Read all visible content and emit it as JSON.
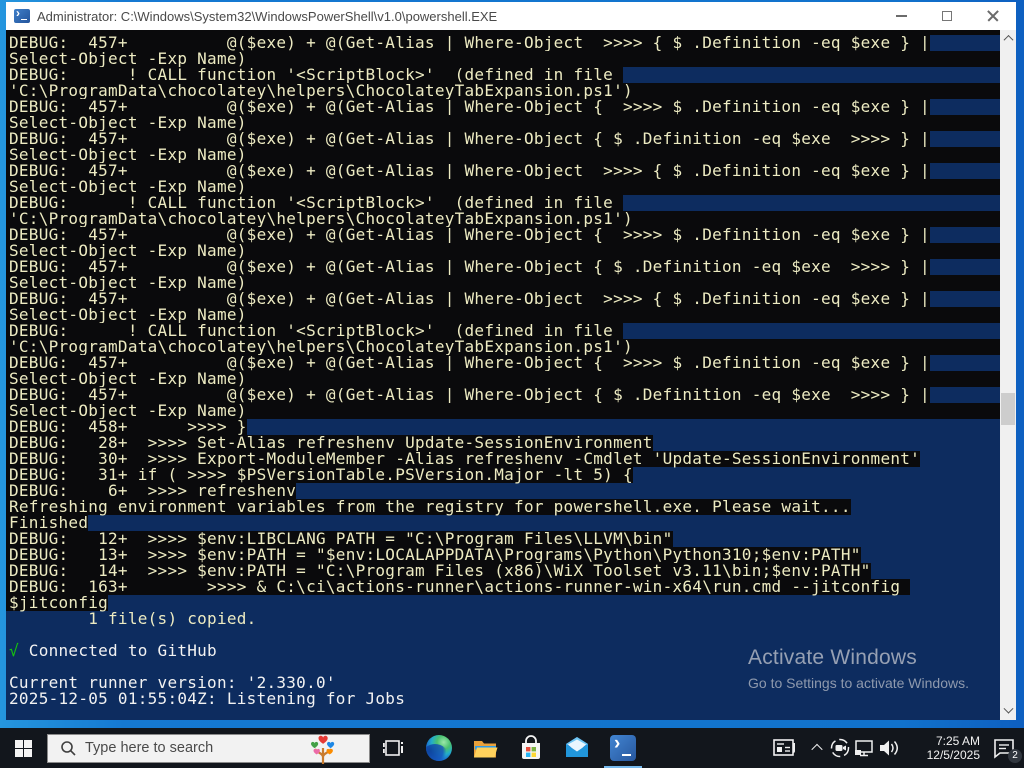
{
  "window": {
    "title": "Administrator: C:\\Windows\\System32\\WindowsPowerShell\\v1.0\\powershell.EXE"
  },
  "console": {
    "rows": [
      {
        "z": 1,
        "c": "b",
        "s": [
          {
            "t": "DEBUG:  457+          @($exe) + @(Get-Alias | Where-Object  >>>> { $_.Definition -eq $exe } |",
            "f": "y"
          }
        ]
      },
      {
        "z": 1,
        "c": "k",
        "s": [
          {
            "t": "Select-Object -Exp Name)",
            "f": "y"
          }
        ]
      },
      {
        "z": 1,
        "c": "b",
        "s": [
          {
            "t": "DEBUG:      ! CALL function '<ScriptBlock>'  (defined in file ",
            "f": "y"
          }
        ]
      },
      {
        "z": 1,
        "c": "k",
        "s": [
          {
            "t": "'C:\\ProgramData\\chocolatey\\helpers\\ChocolateyTabExpansion.ps1')",
            "f": "y"
          }
        ]
      },
      {
        "z": 1,
        "c": "b",
        "s": [
          {
            "t": "DEBUG:  457+          @($exe) + @(Get-Alias | Where-Object {  >>>> $_.Definition -eq $exe } |",
            "f": "y"
          }
        ]
      },
      {
        "z": 1,
        "c": "k",
        "s": [
          {
            "t": "Select-Object -Exp Name)",
            "f": "y"
          }
        ]
      },
      {
        "z": 1,
        "c": "b",
        "s": [
          {
            "t": "DEBUG:  457+          @($exe) + @(Get-Alias | Where-Object { $_.Definition -eq $exe  >>>> } |",
            "f": "y"
          }
        ]
      },
      {
        "z": 1,
        "c": "k",
        "s": [
          {
            "t": "Select-Object -Exp Name)",
            "f": "y"
          }
        ]
      },
      {
        "z": 1,
        "c": "b",
        "s": [
          {
            "t": "DEBUG:  457+          @($exe) + @(Get-Alias | Where-Object  >>>> { $_.Definition -eq $exe } |",
            "f": "y"
          }
        ]
      },
      {
        "z": 1,
        "c": "k",
        "s": [
          {
            "t": "Select-Object -Exp Name)",
            "f": "y"
          }
        ]
      },
      {
        "z": 1,
        "c": "b",
        "s": [
          {
            "t": "DEBUG:      ! CALL function '<ScriptBlock>'  (defined in file ",
            "f": "y"
          }
        ]
      },
      {
        "z": 1,
        "c": "k",
        "s": [
          {
            "t": "'C:\\ProgramData\\chocolatey\\helpers\\ChocolateyTabExpansion.ps1')",
            "f": "y"
          }
        ]
      },
      {
        "z": 1,
        "c": "b",
        "s": [
          {
            "t": "DEBUG:  457+          @($exe) + @(Get-Alias | Where-Object {  >>>> $_.Definition -eq $exe } |",
            "f": "y"
          }
        ]
      },
      {
        "z": 1,
        "c": "k",
        "s": [
          {
            "t": "Select-Object -Exp Name)",
            "f": "y"
          }
        ]
      },
      {
        "z": 1,
        "c": "b",
        "s": [
          {
            "t": "DEBUG:  457+          @($exe) + @(Get-Alias | Where-Object { $_.Definition -eq $exe  >>>> } |",
            "f": "y"
          }
        ]
      },
      {
        "z": 1,
        "c": "k",
        "s": [
          {
            "t": "Select-Object -Exp Name)",
            "f": "y"
          }
        ]
      },
      {
        "z": 1,
        "c": "b",
        "s": [
          {
            "t": "DEBUG:  457+          @($exe) + @(Get-Alias | Where-Object  >>>> { $_.Definition -eq $exe } |",
            "f": "y"
          }
        ]
      },
      {
        "z": 1,
        "c": "k",
        "s": [
          {
            "t": "Select-Object -Exp Name)",
            "f": "y"
          }
        ]
      },
      {
        "z": 1,
        "c": "b",
        "s": [
          {
            "t": "DEBUG:      ! CALL function '<ScriptBlock>'  (defined in file ",
            "f": "y"
          }
        ]
      },
      {
        "z": 1,
        "c": "k",
        "s": [
          {
            "t": "'C:\\ProgramData\\chocolatey\\helpers\\ChocolateyTabExpansion.ps1')",
            "f": "y"
          }
        ]
      },
      {
        "z": 1,
        "c": "b",
        "s": [
          {
            "t": "DEBUG:  457+          @($exe) + @(Get-Alias | Where-Object {  >>>> $_.Definition -eq $exe } |",
            "f": "y"
          }
        ]
      },
      {
        "z": 1,
        "c": "k",
        "s": [
          {
            "t": "Select-Object -Exp Name)",
            "f": "y"
          }
        ]
      },
      {
        "z": 1,
        "c": "b",
        "s": [
          {
            "t": "DEBUG:  457+          @($exe) + @(Get-Alias | Where-Object { $_.Definition -eq $exe  >>>> } |",
            "f": "y"
          }
        ]
      },
      {
        "z": 1,
        "c": "k",
        "s": [
          {
            "t": "Select-Object -Exp Name)",
            "f": "y"
          }
        ]
      },
      {
        "z": 2,
        "c": "b",
        "s": [
          {
            "t": "DEBUG:  458+      >>>> }",
            "f": "y"
          }
        ]
      },
      {
        "z": 2,
        "c": "b",
        "s": [
          {
            "t": "DEBUG:   28+  >>>> Set-Alias refreshenv Update-SessionEnvironment",
            "f": "y"
          }
        ]
      },
      {
        "z": 2,
        "c": "b",
        "s": [
          {
            "t": "DEBUG:   30+  >>>> Export-ModuleMember -Alias refreshenv -Cmdlet 'Update-SessionEnvironment'",
            "f": "y"
          }
        ]
      },
      {
        "z": 2,
        "c": "b",
        "s": [
          {
            "t": "DEBUG:   31+ if ( >>>> $PSVersionTable.PSVersion.Major -lt 5) {",
            "f": "y"
          }
        ]
      },
      {
        "z": 2,
        "c": "b",
        "s": [
          {
            "t": "DEBUG:    6+  >>>> refreshenv",
            "f": "y"
          }
        ]
      },
      {
        "z": 2,
        "c": "b",
        "s": [
          {
            "t": "Refreshing environment variables from the registry for powershell.exe. Please wait...",
            "f": "y"
          }
        ]
      },
      {
        "z": 2,
        "c": "b",
        "s": [
          {
            "t": "Finished",
            "f": "y"
          }
        ]
      },
      {
        "z": 2,
        "c": "b",
        "s": [
          {
            "t": "DEBUG:   12+  >>>> $env:LIBCLANG_PATH = \"C:\\Program Files\\LLVM\\bin\"",
            "f": "y"
          }
        ]
      },
      {
        "z": 2,
        "c": "b",
        "s": [
          {
            "t": "DEBUG:   13+  >>>> $env:PATH = \"$env:LOCALAPPDATA\\Programs\\Python\\Python310;$env:PATH\"",
            "f": "y"
          }
        ]
      },
      {
        "z": 2,
        "c": "b",
        "s": [
          {
            "t": "DEBUG:   14+  >>>> $env:PATH = \"C:\\Program Files (x86)\\WiX Toolset v3.11\\bin;$env:PATH\"",
            "f": "y"
          }
        ]
      },
      {
        "z": 2,
        "c": "b",
        "s": [
          {
            "t": "DEBUG:  163+        >>>> & C:\\ci\\actions-runner\\actions-runner-win-x64\\run.cmd --jitconfig ",
            "f": "y"
          }
        ]
      },
      {
        "z": 2,
        "c": "b",
        "s": [
          {
            "t": "$jitconfig",
            "f": "y"
          }
        ]
      },
      {
        "z": 3,
        "c": "n",
        "s": [
          {
            "t": "        1 file(s) copied.",
            "f": "y"
          }
        ]
      },
      {
        "z": 3,
        "c": "n",
        "s": []
      },
      {
        "z": 3,
        "c": "n",
        "s": [
          {
            "t": "√",
            "f": "g"
          },
          {
            "t": " Connected to GitHub",
            "f": "w"
          }
        ]
      },
      {
        "z": 3,
        "c": "n",
        "s": []
      },
      {
        "z": 3,
        "c": "n",
        "s": [
          {
            "t": "Current runner version: '2.330.0'",
            "f": "w"
          }
        ]
      },
      {
        "z": 3,
        "c": "n",
        "s": [
          {
            "t": "2025-12-05 01:55:04Z: Listening for Jobs",
            "f": "w"
          }
        ]
      }
    ],
    "watermark": {
      "line1": "Activate Windows",
      "line2": "Go to Settings to activate Windows."
    }
  },
  "colors": {
    "console_black": "#0A0A0C",
    "console_navy": "#0D2C5F",
    "text_yellow": "#EDEBC2",
    "text_white": "#F2F2F2",
    "text_green": "#16C60C",
    "window_border_blue": "#1579D2",
    "taskbar_bg": "#12161C"
  },
  "taskbar": {
    "search_placeholder": "Type here to search",
    "clock": {
      "time": "7:25 AM",
      "date": "12/5/2025"
    },
    "notification_badge": "2",
    "icons": [
      "start-icon",
      "search-icon",
      "search-highlights-tree-icon",
      "task-view-icon",
      "edge-icon",
      "file-explorer-icon",
      "store-icon",
      "mail-icon",
      "powershell-icon",
      "news-icon",
      "tray-expand-icon",
      "meet-now-icon",
      "network-icon",
      "volume-icon",
      "action-center-icon"
    ]
  }
}
